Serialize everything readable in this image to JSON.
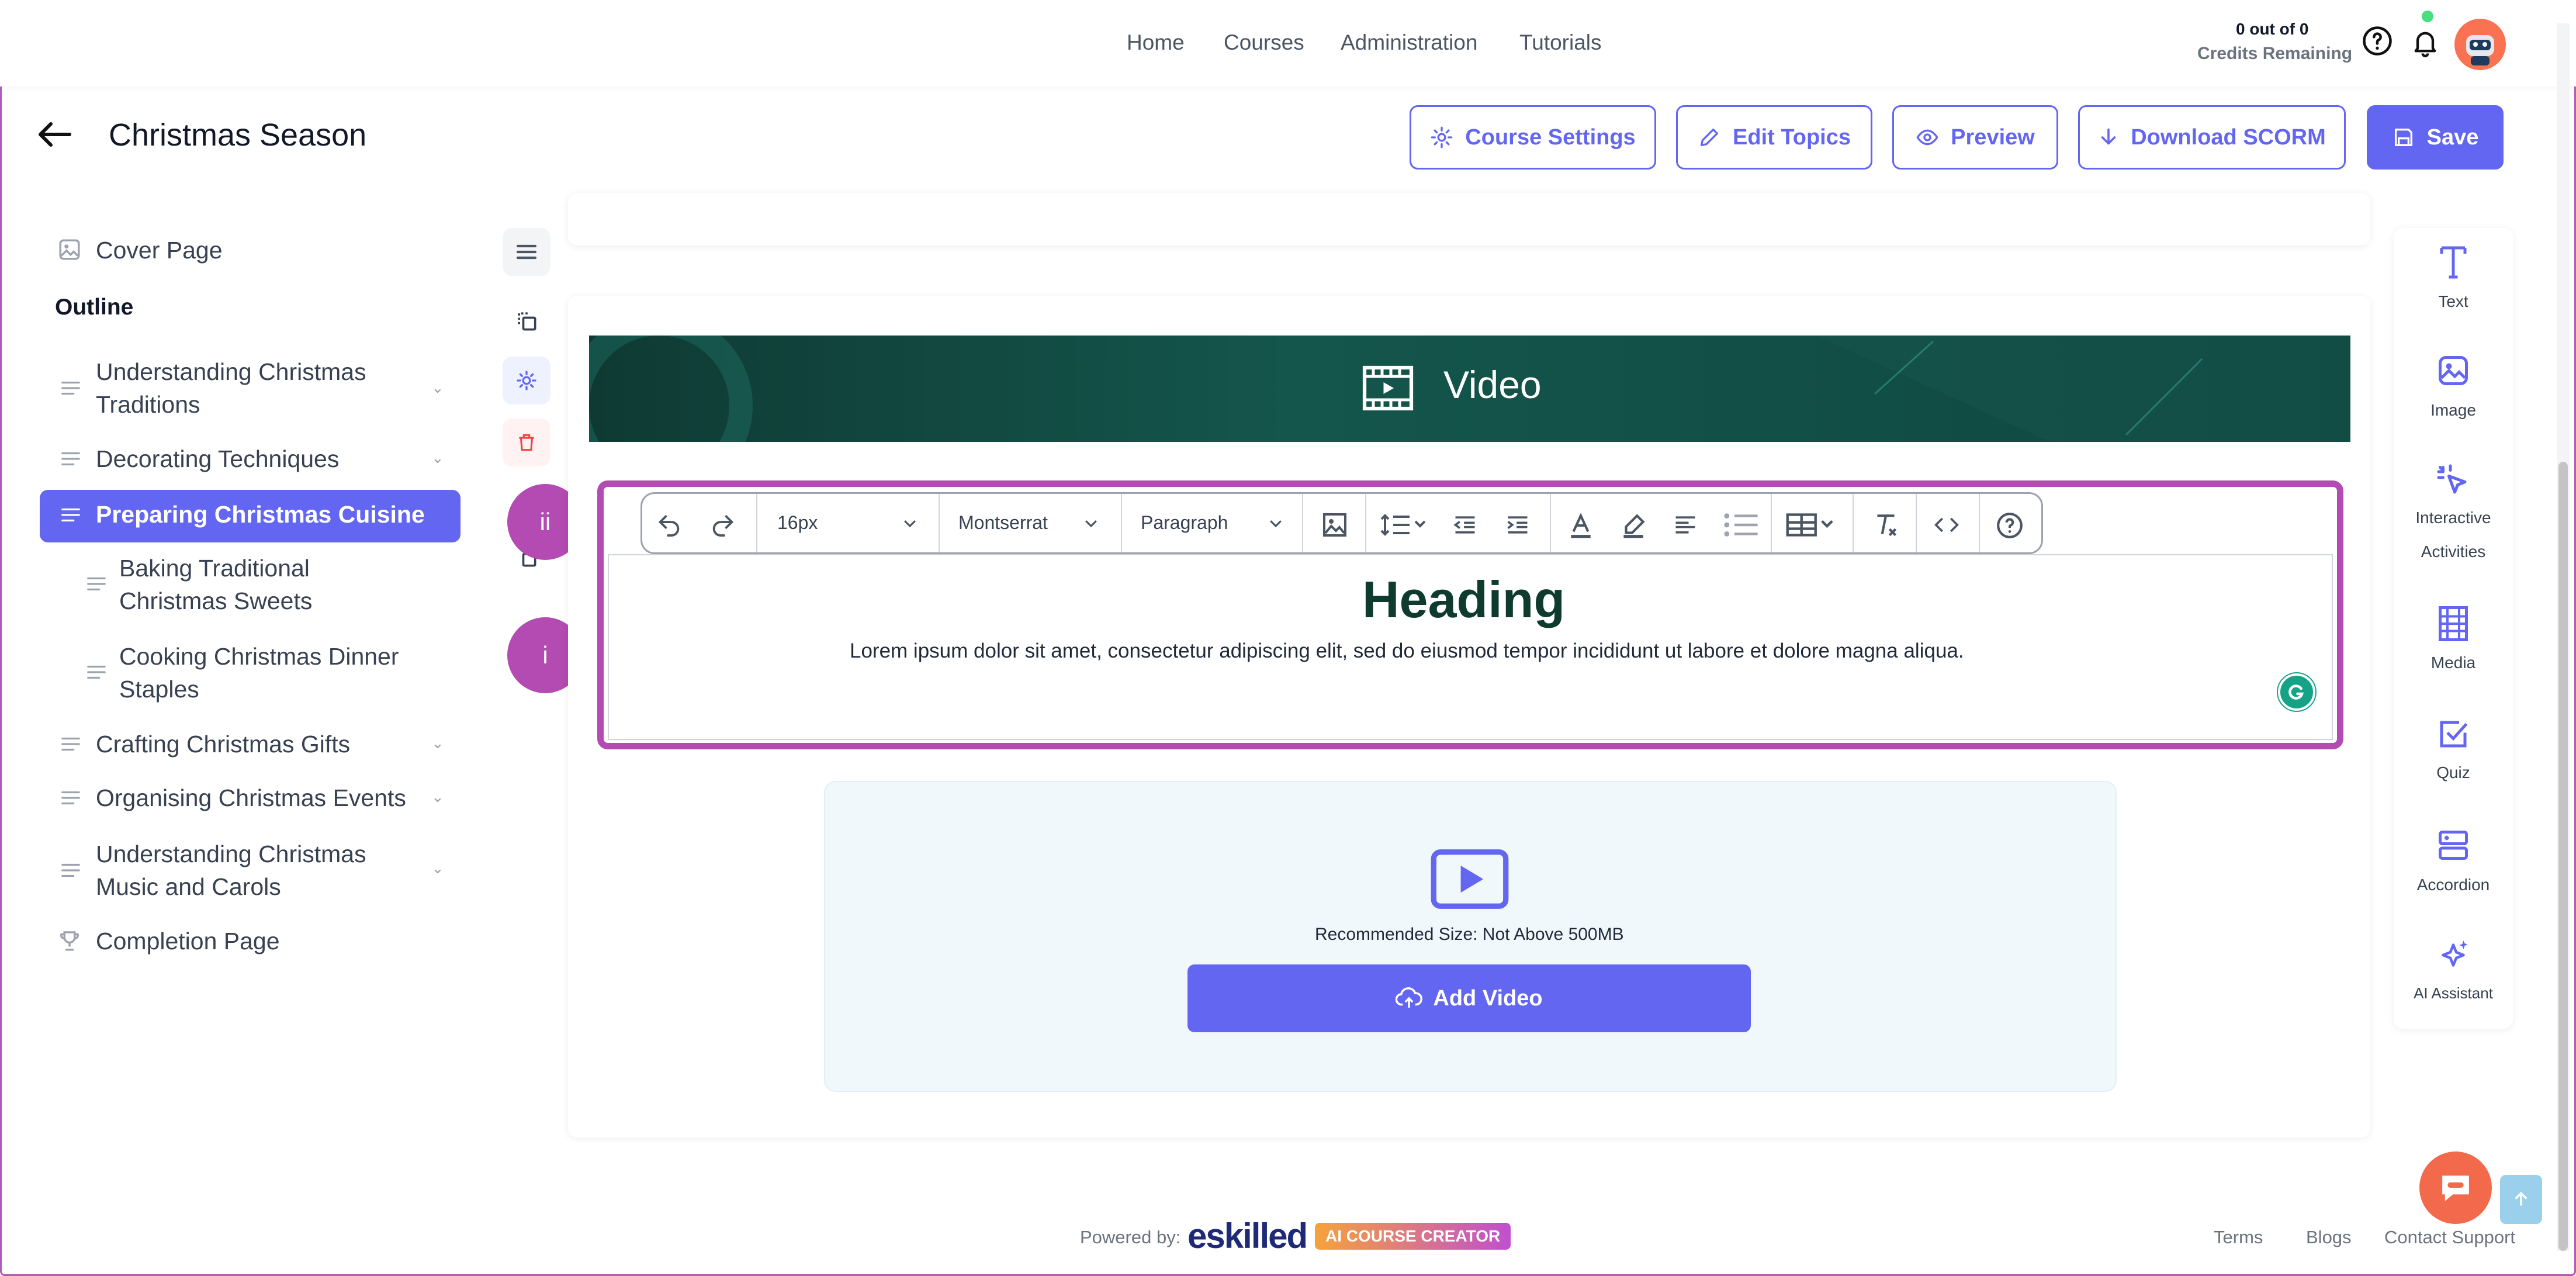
{
  "nav": {
    "links": [
      "Home",
      "Courses",
      "Administration",
      "Tutorials"
    ],
    "credits_count": "0 out of 0",
    "credits_label": "Credits Remaining"
  },
  "header": {
    "title": "Christmas Season",
    "buttons": {
      "settings": "Course Settings",
      "edit": "Edit Topics",
      "preview": "Preview",
      "download": "Download SCORM",
      "save": "Save"
    }
  },
  "sidebar": {
    "cover": "Cover Page",
    "outline": "Outline",
    "items": [
      {
        "label": "Understanding Christmas Traditions"
      },
      {
        "label": "Decorating Techniques"
      },
      {
        "label": "Preparing Christmas Cuisine"
      },
      {
        "label": "Baking Traditional Christmas Sweets"
      },
      {
        "label": "Cooking Christmas Dinner Staples"
      },
      {
        "label": "Crafting Christmas Gifts"
      },
      {
        "label": "Organising Christmas Events"
      },
      {
        "label": "Understanding Christmas Music and Carols"
      }
    ],
    "completion": "Completion Page"
  },
  "canvas": {
    "banner_title": "Video",
    "toolbar": {
      "font_size": "16px",
      "font_family": "Montserrat",
      "block": "Paragraph"
    },
    "heading": "Heading",
    "body_text": "Lorem ipsum dolor sit amet, consectetur adipiscing elit, sed do eiusmod tempor incididunt ut labore et dolore magna aliqua.",
    "markers": {
      "upper": "ii",
      "lower": "i"
    },
    "upload": {
      "recommended": "Recommended Size: Not Above 500MB",
      "add_button": "Add Video"
    }
  },
  "right_panel": {
    "items": [
      "Text",
      "Image",
      "Interactive",
      "Activities",
      "Media",
      "Quiz",
      "Accordion",
      "AI Assistant"
    ]
  },
  "footer": {
    "powered_by": "Powered by:",
    "brand": "eskilled",
    "badge": "AI COURSE CREATOR",
    "links": [
      "Terms",
      "Blogs",
      "Contact Support"
    ]
  },
  "colors": {
    "accent": "#6366f1",
    "highlight": "#b34bb2",
    "banner": "#0f3a34"
  }
}
